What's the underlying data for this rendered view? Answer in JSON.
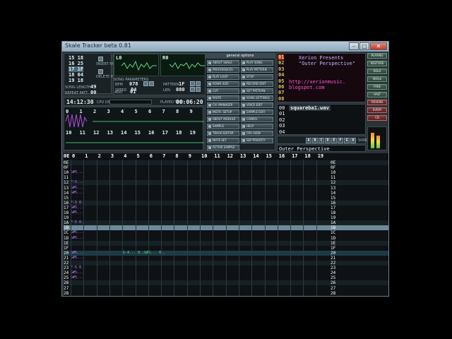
{
  "window": {
    "title": "Skale Tracker beta 0.81",
    "minimize": "–",
    "maximize": "□",
    "close": "✕"
  },
  "left_info": {
    "order_rows": [
      "15 18",
      "16 25",
      "17 1F",
      "18 04",
      "19 18"
    ],
    "song_params_label": "SONG PARAMETERS",
    "bpm_label": "BPM",
    "bpm": "078",
    "speed_label": "SPEED",
    "speed": "04",
    "add_label": "ADD",
    "add": "01",
    "pattern_label": "PATTERN",
    "pattern": "1F",
    "len_label": "LEN.",
    "len": "080",
    "song_length_label": "SONG LENGTH",
    "song_length": "49",
    "repeat_label": "REPEAT PATT.",
    "repeat": "00",
    "time": "14:12:30",
    "cpu_label": "CPU USAGE",
    "played_label": "PLAYED TIME",
    "played": "00:06:20",
    "insert_label": "INSERT PATTERN",
    "delete_label": "DELETE PATTERN"
  },
  "scopes": {
    "left": "L0",
    "right": "R0"
  },
  "channel_numbers_top": [
    "0",
    "1",
    "2",
    "3",
    "4",
    "5",
    "6",
    "7",
    "8",
    "9"
  ],
  "channel_numbers_bottom": [
    "10",
    "11",
    "12",
    "13",
    "14",
    "15",
    "16",
    "17",
    "18",
    "19"
  ],
  "general_options": {
    "title": "general options",
    "col1": [
      "ABOUT SKALE",
      "PREFERENCES",
      "PLAY LOOP",
      "ROWS SIZE",
      "CUT",
      "PASTE",
      "CH. MANAGER",
      "INSTR. SETUP",
      "ABOUT MODULE",
      "SAMPLE",
      "TRACK EDITOR",
      "NOTE SET",
      "ACTIVE SAMPLE"
    ],
    "col2": [
      "PLAY SONG",
      "PLAY PATTERN",
      "STOP",
      "RECORD EDIT",
      "SET PATTERN",
      "SONG SETTINGS",
      "VOICE EDIT",
      "SAMPLE EDIT",
      "CONFIG",
      "HELP",
      "CPU VIEW",
      "SEP PRIORITY"
    ]
  },
  "right_panel": {
    "instrument_nums": [
      "01",
      "02",
      "03",
      "04",
      "05",
      "06",
      "07",
      "08"
    ],
    "text_lines": [
      "Xerion Presents",
      "\"Outer Perspective\"",
      "",
      "",
      "http://xerionmusic.",
      "blogspot.com",
      ""
    ],
    "sample_rows": [
      "00",
      "01",
      "02",
      "03",
      "04"
    ],
    "sample_name": "squareba1.wav",
    "song_name": "Outer Perspective",
    "keys": [
      "A",
      "B",
      "C",
      "D",
      "E",
      "F",
      "G",
      "H"
    ],
    "song_title_label": "SONG TITLE"
  },
  "side_buttons": [
    "PLAYING",
    "RESTORE",
    "SOLO",
    "SKALE",
    "FREE",
    "HALT",
    "REVERB",
    "EVERY",
    "CD"
  ],
  "pattern_grid": {
    "channels": [
      "0",
      "1",
      "2",
      "3",
      "4",
      "5",
      "6",
      "7",
      "8",
      "9",
      "10",
      "11",
      "12",
      "13",
      "14",
      "15",
      "16",
      "17",
      "18",
      "19"
    ],
    "rows": [
      "0E",
      "0F",
      "10",
      "11",
      "12",
      "13",
      "14",
      "15",
      "16",
      "17",
      "18",
      "19",
      "1A",
      "1B",
      "1C",
      "1D",
      "1E",
      "1F",
      "20",
      "21",
      "22",
      "23",
      "24",
      "25",
      "26",
      "27",
      "28"
    ],
    "notes": {
      "10": "G#5...",
      "12": "F-5...",
      "13": "G#5...",
      "14": "G#5...",
      "16": "F-5 0.",
      "17": "G#5...",
      "18": "G#5...",
      "1A": "F-5 0.",
      "1C": "G#5...",
      "1D": "G#5...",
      "20": "G#5...",
      "21": "G#5...",
      "23": "F-5 0.",
      "24": "G#5...",
      "25": "G#5..."
    },
    "highlight_text": "G-4... 0..G#5... 0..",
    "empty_cell": "... ..."
  }
}
